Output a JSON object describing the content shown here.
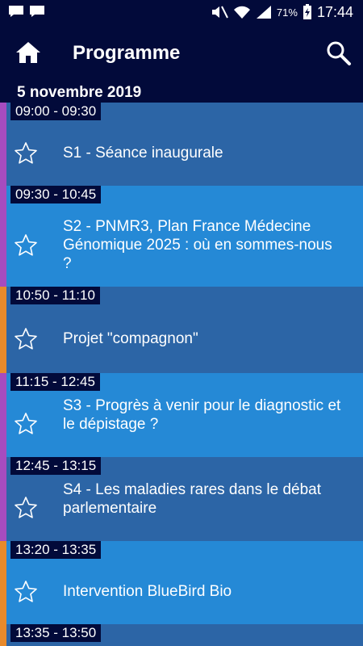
{
  "status_bar": {
    "notification_icons": [
      "chat-icon",
      "chat-icon"
    ],
    "battery_percent": "71%",
    "time": "17:44"
  },
  "app_bar": {
    "title": "Programme",
    "home_icon": "home-icon",
    "search_icon": "search-icon"
  },
  "date_header": "5 novembre 2019",
  "colors": {
    "dark_bar": "#020a3a",
    "item_dark": "#2c65a6",
    "item_light": "#2589d6",
    "track_purple": "#a64cbf",
    "track_orange": "#e88a2b"
  },
  "sessions": [
    {
      "time": "09:00 - 09:30",
      "title": "S1 - Séance inaugurale",
      "track": "purple",
      "shade": "dark"
    },
    {
      "time": "09:30 - 10:45",
      "title": "S2 - PNMR3, Plan France Médecine Génomique 2025 : où en sommes-nous ?",
      "track": "purple",
      "shade": "light"
    },
    {
      "time": "10:50 - 11:10",
      "title": "Projet \"compagnon\"",
      "track": "orange",
      "shade": "dark"
    },
    {
      "time": "11:15 - 12:45",
      "title": "S3 - Progrès à venir pour le diagnostic et le dépistage ?",
      "track": "purple",
      "shade": "light"
    },
    {
      "time": "12:45 - 13:15",
      "title": "S4 - Les maladies rares dans le débat parlementaire",
      "track": "purple",
      "shade": "dark"
    },
    {
      "time": "13:20 - 13:35",
      "title": "Intervention BlueBird Bio",
      "track": "orange",
      "shade": "light"
    },
    {
      "time": "13:35 - 13:50",
      "title": "",
      "track": "orange",
      "shade": "dark"
    }
  ]
}
